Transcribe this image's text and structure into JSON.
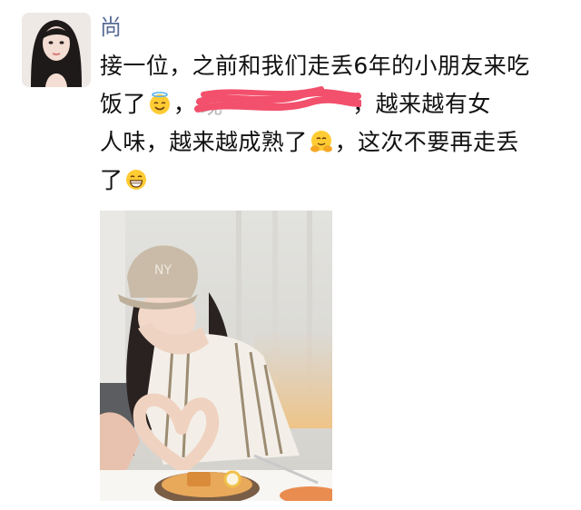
{
  "post": {
    "author": "尚",
    "lines": [
      "接一位，之前和我们走丢6年的小朋友来吃",
      "饭了",
      "，",
      "，越来越有女",
      "人味，越来越成熟了",
      "，这次不要再走丢",
      "了"
    ],
    "emojis": [
      "smiling-face-with-halo",
      "hugging-face",
      "grinning-face"
    ],
    "redacted_hint": "现 "
  },
  "colors": {
    "author_name": "#576b95",
    "redaction": "#f2506c",
    "text": "#111111"
  }
}
